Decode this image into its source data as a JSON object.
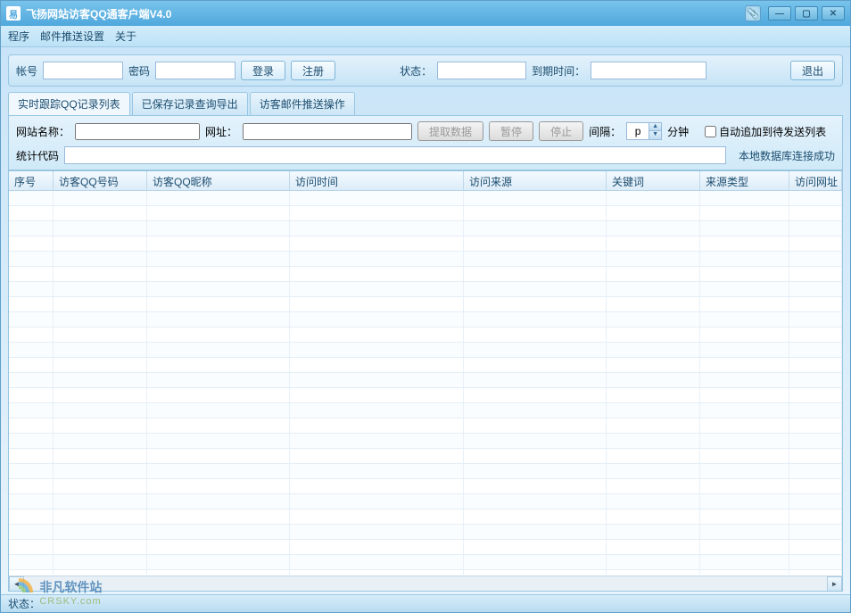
{
  "window": {
    "title": "飞扬网站访客QQ通客户端V4.0",
    "icon_text": "易"
  },
  "menu": {
    "program": "程序",
    "mail_settings": "邮件推送设置",
    "about": "关于"
  },
  "login": {
    "account_label": "帐号",
    "password_label": "密码",
    "login_btn": "登录",
    "register_btn": "注册",
    "status_label": "状态：",
    "status_value": "",
    "expire_label": "到期时间：",
    "expire_value": "",
    "exit_btn": "退出"
  },
  "tabs": {
    "t1": "实时跟踪QQ记录列表",
    "t2": "已保存记录查询导出",
    "t3": "访客邮件推送操作"
  },
  "site": {
    "name_label": "网站名称：",
    "url_label": "网址：",
    "fetch_btn": "提取数据",
    "pause_btn": "暂停",
    "stop_btn": "停止",
    "interval_label": "间隔：",
    "interval_value": "p",
    "interval_unit": "分钟",
    "auto_append_label": "自动追加到待发送列表",
    "stat_code_label": "统计代码",
    "db_status": "本地数据库连接成功"
  },
  "table": {
    "columns": {
      "seq": "序号",
      "qq_number": "访客QQ号码",
      "qq_nick": "访客QQ昵称",
      "visit_time": "访问时间",
      "visit_source": "访问来源",
      "keyword": "关键词",
      "source_type": "来源类型",
      "visit_url": "访问网址"
    }
  },
  "col_widths": {
    "seq": 50,
    "qq_number": 105,
    "qq_nick": 160,
    "visit_time": 195,
    "visit_source": 160,
    "keyword": 105,
    "source_type": 100,
    "visit_url": 90
  },
  "statusbar": {
    "label": "状态："
  },
  "watermark": {
    "line1": "非凡软件站",
    "line2": "CRSKY.com"
  }
}
